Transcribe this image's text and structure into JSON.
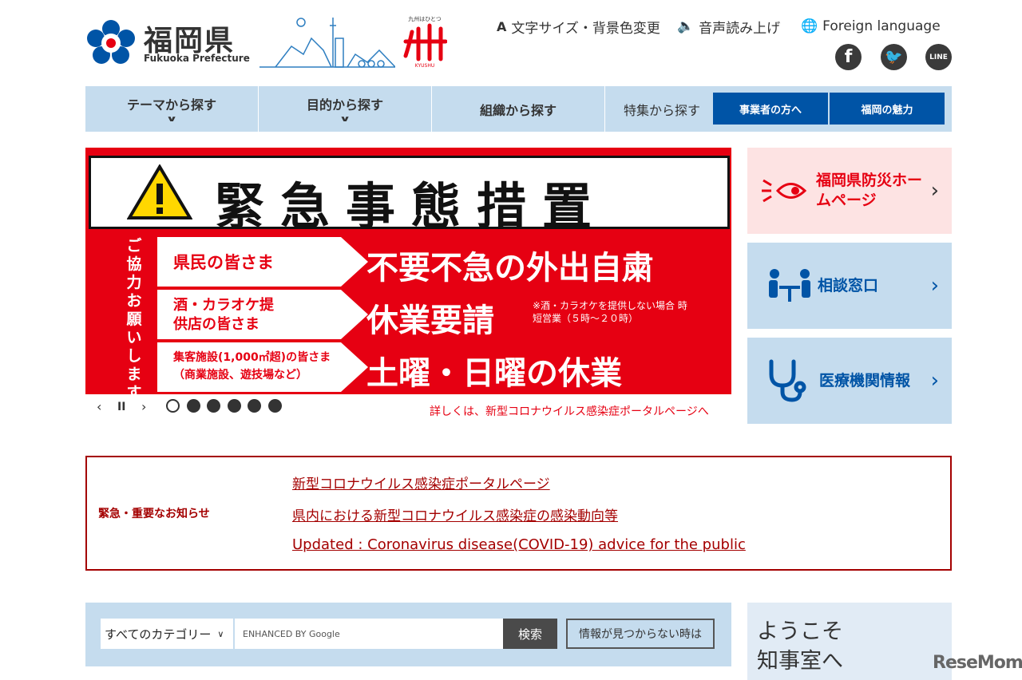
{
  "header": {
    "site_name": "福岡県",
    "site_name_en": "Fukuoka Prefecture",
    "kyushu_tagline": "九州はひとつ",
    "kyushu_label": "KYUSHU",
    "utility": {
      "text_size": "文字サイズ・背景色変更",
      "read_aloud": "音声読み上げ",
      "foreign": "Foreign language"
    },
    "social": [
      "facebook",
      "twitter",
      "line"
    ],
    "line_label": "LINE"
  },
  "nav": {
    "items": [
      "テーマから探す",
      "目的から探す",
      "組織から探す"
    ],
    "feature_label": "特集から探す",
    "feature_buttons": [
      "事業者の方へ",
      "福岡の魅力"
    ]
  },
  "banner": {
    "title": "緊急事態措置",
    "vertical_text": "ご協力お願いします",
    "rows": [
      {
        "target": "県民の皆さま",
        "request": "不要不急の外出自粛"
      },
      {
        "target": "酒・カラオケ提供店の皆さま",
        "request": "休業要請"
      },
      {
        "target": "集客施設(1,000㎡超)の皆さま（商業施設、遊技場など）",
        "request": "土曜・日曜の休業"
      }
    ],
    "note": "※酒・カラオケを提供しない場合 時短営業（５時～２０時）",
    "link": "詳しくは、新型コロナウイルス感染症ポータルページへ",
    "slide_count": 6,
    "active_slide": 1
  },
  "side_cards": [
    {
      "label": "福岡県防災ホームページ",
      "icon": "alert-eye-icon",
      "bg": "#fde3e3",
      "color": "#e60012"
    },
    {
      "label": "相談窓口",
      "icon": "consultation-icon",
      "bg": "#c5dcee",
      "color": "#0054a6"
    },
    {
      "label": "医療機関情報",
      "icon": "stethoscope-icon",
      "bg": "#c5dcee",
      "color": "#0054a6"
    }
  ],
  "notice": {
    "title": "緊急・重要なお知らせ",
    "links": [
      "新型コロナウイルス感染症ポータルページ",
      "県内における新型コロナウイルス感染症の感染動向等",
      "Updated : Coronavirus disease(COVID-19) advice for the public"
    ]
  },
  "search": {
    "category": "すべてのカテゴリー",
    "placeholder": "ENHANCED BY Google",
    "button": "検索",
    "not_found": "情報が見つからない時は"
  },
  "welcome": {
    "line1": "ようこそ",
    "line2": "知事室へ"
  },
  "watermark": "ReseMom"
}
